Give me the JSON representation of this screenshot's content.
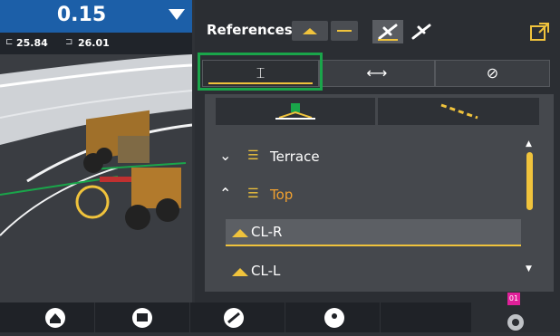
{
  "status": {
    "cut_fill_value": "0.15",
    "left_elevation": "25.84",
    "right_elevation": "26.01"
  },
  "panel": {
    "title": "References",
    "tabs": [
      {
        "name": "vertical",
        "icon": "vertical-offset-icon"
      },
      {
        "name": "horizontal",
        "icon": "horizontal-offset-icon"
      },
      {
        "name": "heading",
        "icon": "compass-icon"
      }
    ],
    "rows": {
      "terrace": "Terrace",
      "top": "Top",
      "cl_r": "CL-R",
      "cl_l": "CL-L"
    },
    "badge": "01"
  },
  "colors": {
    "accent": "#f0c33c",
    "highlight": "#1aa54a",
    "topbar": "#1c5fa8",
    "selected_text": "#f0a030"
  }
}
